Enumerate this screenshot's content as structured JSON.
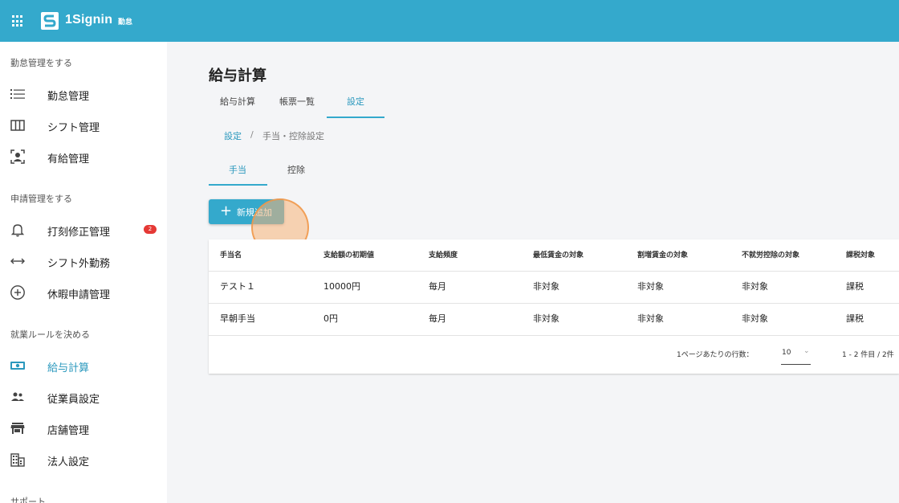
{
  "header": {
    "logo_text": "1Signin",
    "logo_sub": "勤怠",
    "color": "#34a9cc"
  },
  "sidebar": {
    "sections": [
      {
        "label": "勤怠管理をする"
      },
      {
        "label": "申請管理をする"
      },
      {
        "label": "就業ルールを決める"
      },
      {
        "label": "サポート"
      }
    ],
    "items": [
      {
        "label": "勤怠管理",
        "icon": "list-icon"
      },
      {
        "label": "シフト管理",
        "icon": "columns-icon"
      },
      {
        "label": "有給管理",
        "icon": "person-icon"
      },
      {
        "label": "打刻修正管理",
        "icon": "bell-icon",
        "badge": "2"
      },
      {
        "label": "シフト外勤務",
        "icon": "arrows-horizontal-icon"
      },
      {
        "label": "休暇申請管理",
        "icon": "plus-circle-icon"
      },
      {
        "label": "給与計算",
        "icon": "money-icon",
        "active": true
      },
      {
        "label": "従業員設定",
        "icon": "people-icon"
      },
      {
        "label": "店舗管理",
        "icon": "store-icon"
      },
      {
        "label": "法人設定",
        "icon": "building-icon"
      }
    ]
  },
  "main": {
    "title": "給与計算",
    "tabs": [
      {
        "label": "給与計算"
      },
      {
        "label": "帳票一覧"
      },
      {
        "label": "設定",
        "active": true
      }
    ],
    "breadcrumb": {
      "link": "設定",
      "separator": "/",
      "current": "手当・控除設定"
    },
    "subtabs": [
      {
        "label": "手当",
        "active": true
      },
      {
        "label": "控除"
      }
    ],
    "add_button_label": "新規追加",
    "table": {
      "columns": [
        "手当名",
        "支給額の初期値",
        "支給頻度",
        "最低賃金の対象",
        "割増賃金の対象",
        "不就労控除の対象",
        "課税対象"
      ],
      "rows": [
        [
          "テスト１",
          "10000円",
          "毎月",
          "非対象",
          "非対象",
          "非対象",
          "課税"
        ],
        [
          "早朝手当",
          "0円",
          "毎月",
          "非対象",
          "非対象",
          "非対象",
          "課税"
        ]
      ]
    },
    "pagination": {
      "rows_per_page_label": "1ページあたりの行数：",
      "rows_per_page": "10",
      "range": "1 - 2 件目 / 2件"
    }
  }
}
